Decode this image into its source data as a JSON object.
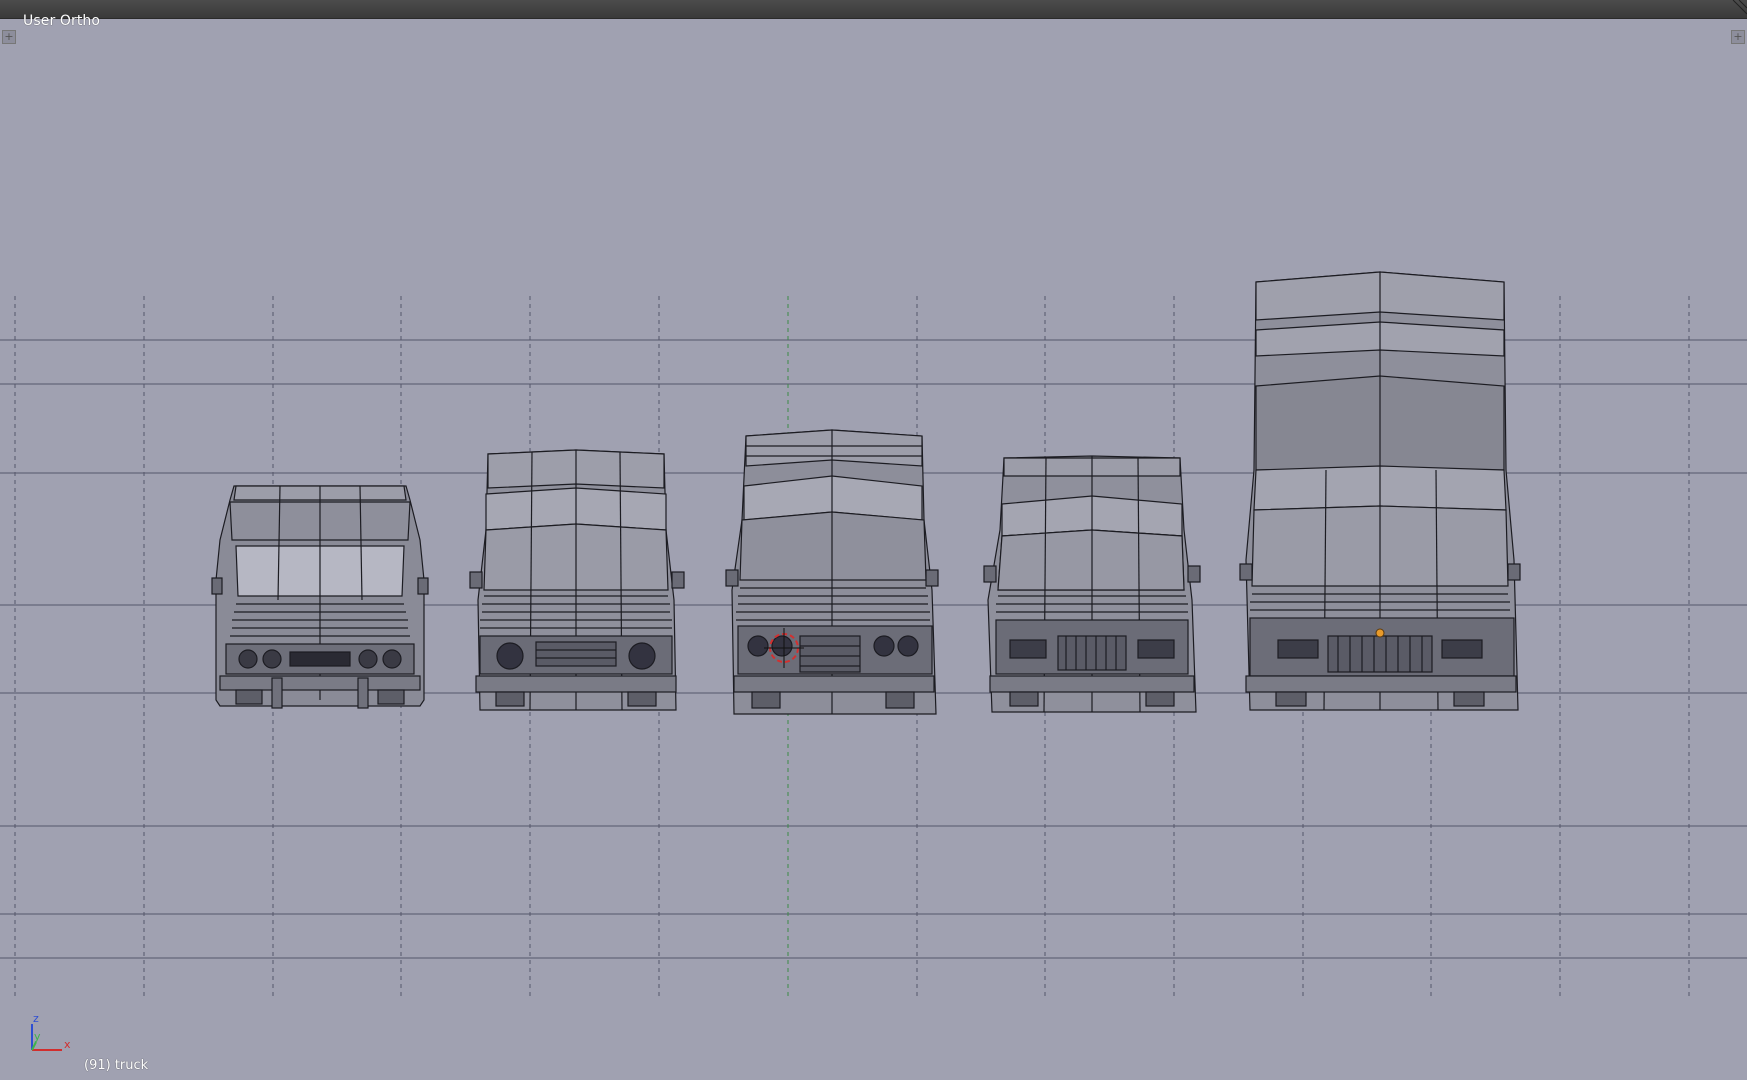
{
  "viewport": {
    "view_label": "User Ortho",
    "object_info": "(91) truck",
    "background_color": "#a0a1b1",
    "grid_line_color": "#4a4a55",
    "active_object_origin_color": "#e89a2a",
    "cursor_color": "#d23030"
  },
  "axis_gizmo": {
    "z_label": "z",
    "y_label": "y",
    "x_label": "x",
    "x_color": "#d22e2e",
    "y_color": "#3cb34a",
    "z_color": "#2e4ed2"
  },
  "scene": {
    "object_count": 5,
    "objects": [
      "truck-cab",
      "truck-box-small",
      "truck-box-medium",
      "truck-box-large",
      "truck-box-tall"
    ]
  },
  "header": {
    "resize_icon": "corner-resize-icon",
    "area_split_left_icon": "plus-icon",
    "area_split_right_icon": "plus-icon"
  }
}
